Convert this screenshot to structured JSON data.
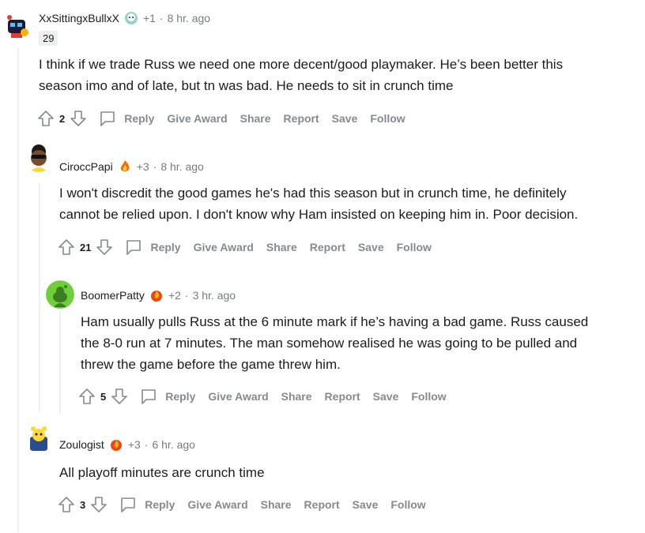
{
  "comments": [
    {
      "username": "XxSittingxBullxX",
      "karma": "+1",
      "time": "8 hr. ago",
      "badge": "29",
      "body_lines": [
        "I think if we trade Russ we need one more decent/good playmaker. He’s been better this",
        "season imo and of late, but tn was bad. He needs to sit in crunch time"
      ],
      "score": "2"
    },
    {
      "username": "CiroccPapi",
      "karma": "+3",
      "time": "8 hr. ago",
      "body_lines": [
        "I won't discredit the good games he's had this season but in crunch time, he definitely",
        "cannot be relied upon. I don't know why Ham insisted on keeping him in. Poor decision."
      ],
      "score": "21"
    },
    {
      "username": "BoomerPatty",
      "karma": "+2",
      "time": "3 hr. ago",
      "body_lines": [
        "Ham usually pulls Russ at the 6 minute mark if he’s having a bad game. Russ caused",
        "the 8-0 run at 7 minutes. The man somehow realised he was going to be pulled and",
        "threw the game before the game threw him."
      ],
      "score": "5"
    },
    {
      "username": "Zoulogist",
      "karma": "+3",
      "time": "6 hr. ago",
      "body_lines": [
        "All playoff minutes are crunch time"
      ],
      "score": "3"
    }
  ],
  "actions": {
    "reply": "Reply",
    "give_award": "Give Award",
    "share": "Share",
    "report": "Report",
    "save": "Save",
    "follow": "Follow"
  },
  "separator": "·",
  "colors": {
    "meta": "#787c7e",
    "action": "#878a8c",
    "thread": "#edeff1"
  }
}
